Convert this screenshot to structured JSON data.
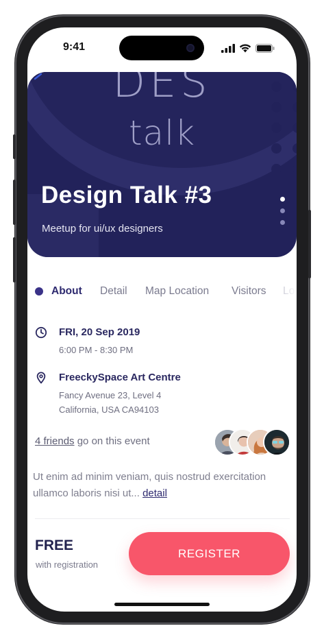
{
  "status_bar": {
    "time": "9:41"
  },
  "hero": {
    "bg_text_top": "DES",
    "bg_text_bottom": "talk",
    "title": "Design Talk #3",
    "subtitle": "Meetup for ui/ux designers",
    "page_count": 3,
    "active_page": 1
  },
  "tabs": [
    {
      "label": "About",
      "active": true
    },
    {
      "label": "Detail",
      "active": false
    },
    {
      "label": "Map Location",
      "active": false
    },
    {
      "label": "Visitors",
      "active": false
    },
    {
      "label": "Lo",
      "active": false
    }
  ],
  "event": {
    "date": "FRI, 20 Sep 2019",
    "time": "6:00 PM - 8:30 PM",
    "venue": "FreeckySpace Art Centre",
    "address_line1": "Fancy Avenue 23, Level 4",
    "address_line2": "California, USA CA94103"
  },
  "friends": {
    "link_text": "4 friends",
    "suffix": " go on this event",
    "avatar_count": 4
  },
  "description": {
    "text": "Ut enim ad minim veniam, quis nostrud exercitation ullamco laboris nisi ut... ",
    "link": "detail"
  },
  "footer": {
    "price": "FREE",
    "price_note": "with registration",
    "register_label": "REGISTER"
  },
  "colors": {
    "hero_bg": "#22225a",
    "primary_text": "#2a2860",
    "accent": "#f8566a",
    "tab_dot": "#3a3288"
  },
  "icons": [
    "back-arrow-icon",
    "clock-icon",
    "location-pin-icon",
    "signal-icon",
    "wifi-icon",
    "battery-icon"
  ]
}
